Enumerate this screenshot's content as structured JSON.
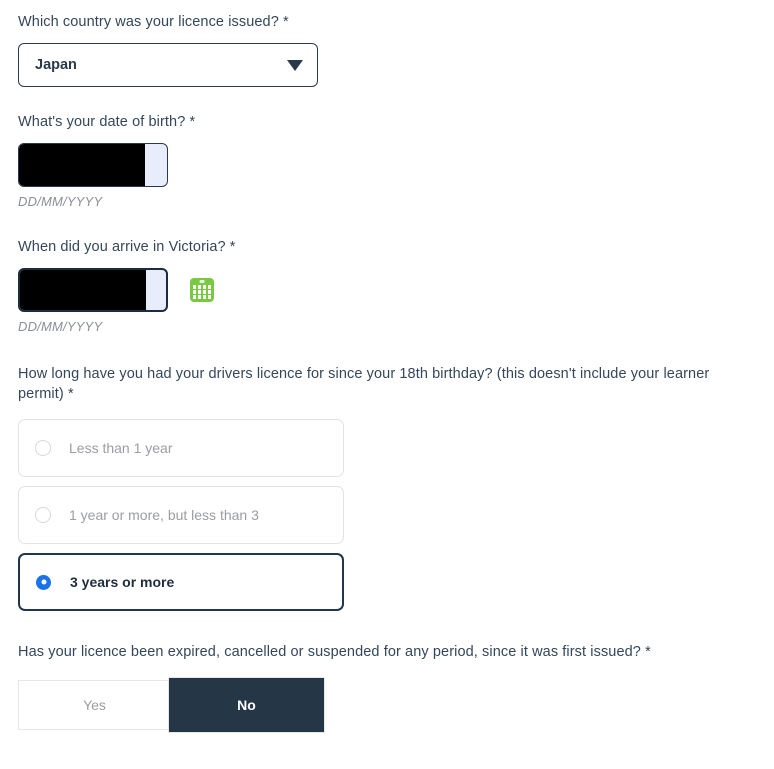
{
  "form": {
    "country_question": {
      "label": "Which country was your licence issued? *",
      "selected_value": "Japan",
      "caret_icon": "chevron-down-icon"
    },
    "dob_question": {
      "label": "What's your date of birth? *",
      "value": "",
      "hint": "DD/MM/YYYY",
      "redacted": "true"
    },
    "arrival_question": {
      "label": "When did you arrive in Victoria? *",
      "value": "",
      "hint": "DD/MM/YYYY",
      "redacted": "true",
      "calendar_icon": "calendar-icon"
    },
    "licence_duration_question": {
      "label": "How long have you had your drivers licence for since your 18th birthday? (this doesn't include your learner permit) *",
      "options": [
        {
          "label": "Less than 1 year",
          "selected": false
        },
        {
          "label": "1 year or more, but less than 3",
          "selected": false
        },
        {
          "label": "3 years or more",
          "selected": true
        }
      ]
    },
    "expiry_question": {
      "label": "Has your licence been expired, cancelled or suspended for any period, since it was first issued? *",
      "options": [
        {
          "label": "Yes",
          "selected": false
        },
        {
          "label": "No",
          "selected": true
        }
      ]
    }
  },
  "colors": {
    "text": "#2b3a4a",
    "accent_blue": "#1a73e8",
    "calendar_green": "#7ac943",
    "selected_dark": "#253746",
    "input_fill": "#e7edfa"
  }
}
